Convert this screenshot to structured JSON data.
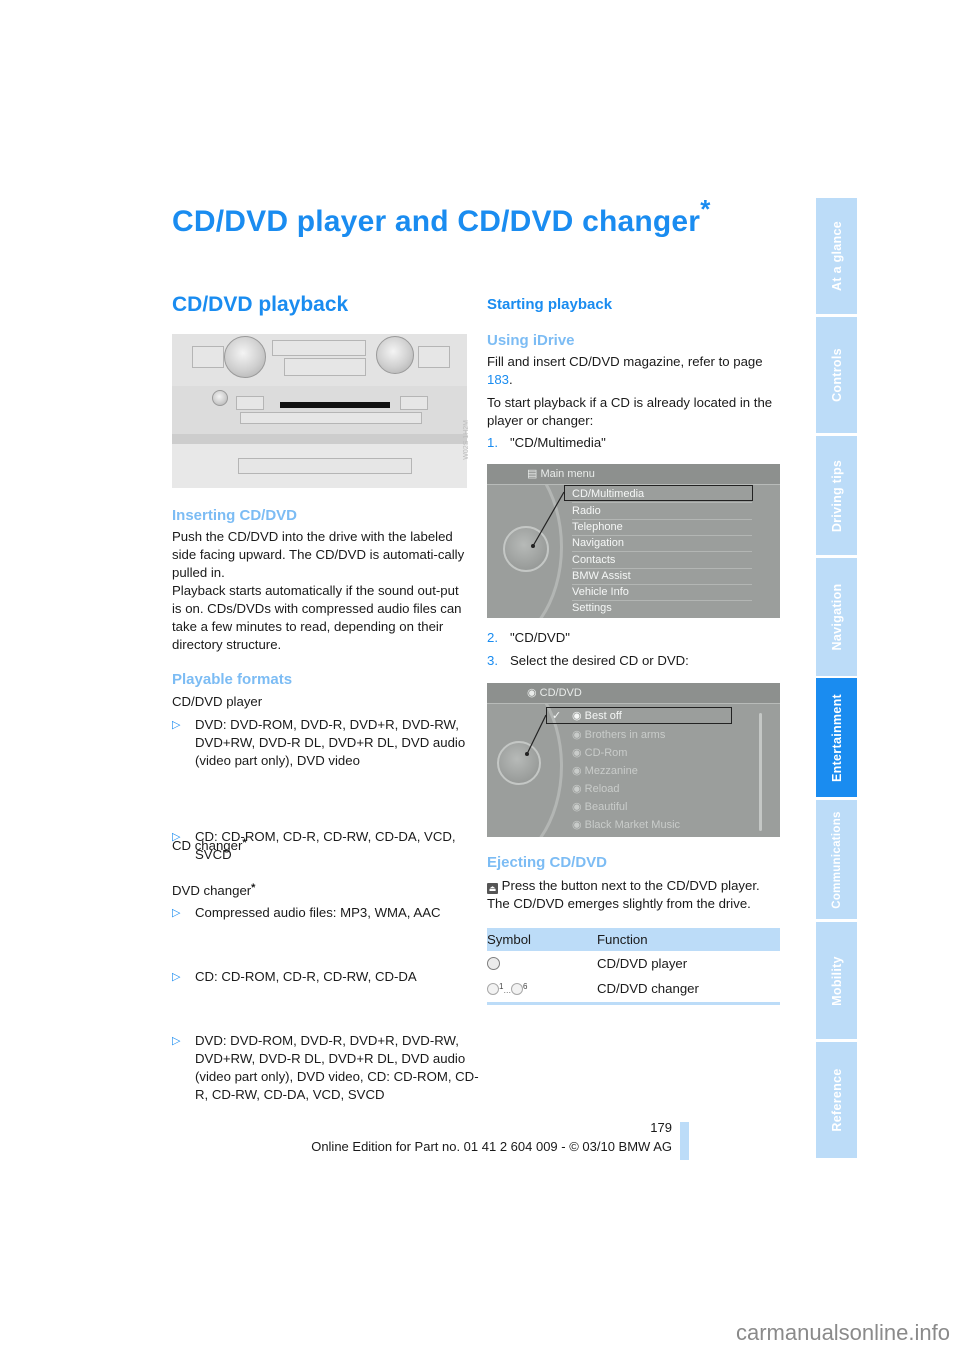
{
  "page": {
    "title": "CD/DVD player and CD/DVD changer",
    "title_star": "*",
    "page_number": "179",
    "footer": "Online Edition for Part no. 01 41 2 604 009 - © 03/10 BMW AG",
    "watermark": "carmanualsonline.info"
  },
  "side_tabs": [
    {
      "label": "At a glance",
      "active": false
    },
    {
      "label": "Controls",
      "active": false
    },
    {
      "label": "Driving tips",
      "active": false
    },
    {
      "label": "Navigation",
      "active": false
    },
    {
      "label": "Entertainment",
      "active": true
    },
    {
      "label": "Communications",
      "active": false
    },
    {
      "label": "Mobility",
      "active": false
    },
    {
      "label": "Reference",
      "active": false
    }
  ],
  "left_column": {
    "heading": "CD/DVD playback",
    "photo_code": "W02S 1H2M",
    "inserting": {
      "heading": "Inserting CD/DVD",
      "paragraphs": [
        "Push the CD/DVD into the drive with the labeled side facing upward. The CD/DVD is automati-cally pulled in.",
        "Playback starts automatically if the sound out-put is on. CDs/DVDs with compressed audio files can take a few minutes to read, depending on their directory structure."
      ]
    },
    "formats": {
      "heading": "Playable formats",
      "player_label": "CD/DVD player",
      "player_items": [
        "DVD: DVD-ROM, DVD-R, DVD+R, DVD-RW, DVD+RW, DVD-R DL, DVD+R DL, DVD audio (video part only), DVD video",
        "CD: CD-ROM, CD-R, CD-RW, CD-DA, VCD, SVCD",
        "Compressed audio files: MP3, WMA, AAC"
      ],
      "cd_changer_label": "CD changer",
      "cd_changer_items": [
        "CD: CD-ROM, CD-R, CD-RW, CD-DA"
      ],
      "dvd_changer_label": "DVD changer",
      "dvd_changer_items": [
        "DVD: DVD-ROM, DVD-R, DVD+R, DVD-RW, DVD+RW, DVD-R DL, DVD+R DL, DVD audio (video part only), DVD video, CD: CD-ROM, CD-R, CD-RW, CD-DA, VCD, SVCD"
      ],
      "star": "*"
    }
  },
  "right_column": {
    "heading": "Starting playback",
    "idrive": {
      "heading": "Using iDrive",
      "p1_before": "Fill and insert CD/DVD magazine, refer to page ",
      "p1_link": "183",
      "p1_after": ".",
      "p2": "To start playback if a CD is already located in the player or changer:",
      "steps": [
        {
          "num": "1.",
          "text": "\"CD/Multimedia\""
        },
        {
          "num": "2.",
          "text": "\"CD/DVD\""
        },
        {
          "num": "3.",
          "text": "Select the desired CD or DVD:"
        }
      ]
    },
    "main_menu_screen": {
      "header": "Main menu",
      "items": [
        "CD/Multimedia",
        "Radio",
        "Telephone",
        "Navigation",
        "Contacts",
        "BMW Assist",
        "Vehicle Info",
        "Settings"
      ],
      "selected": "CD/Multimedia"
    },
    "cddvd_screen": {
      "header": "CD/DVD",
      "items": [
        "Best off",
        "Brothers in arms",
        "CD-Rom",
        "Mezzanine",
        "Reload",
        "Beautiful",
        "Black Market Music"
      ],
      "selected": "Best off",
      "check": "✓"
    },
    "ejecting": {
      "heading": "Ejecting CD/DVD",
      "eject_icon": "eject-icon",
      "p1": " Press the button next to the CD/DVD player.",
      "p2": "The CD/DVD emerges slightly from the drive."
    },
    "symbol_table": {
      "headers": [
        "Symbol",
        "Function"
      ],
      "rows": [
        {
          "symbol": "cd-dvd-player-icon",
          "function": "CD/DVD player"
        },
        {
          "symbol": "cd-dvd-changer-icon",
          "symbol_from": "1",
          "symbol_sep": "...",
          "symbol_to": "6",
          "function": "CD/DVD changer"
        }
      ]
    }
  },
  "colors": {
    "accent": "#1a8cf0",
    "subheading": "#7cbcf4",
    "tab_bg": "#bcdcf8",
    "tab_active": "#1a8cf0"
  }
}
